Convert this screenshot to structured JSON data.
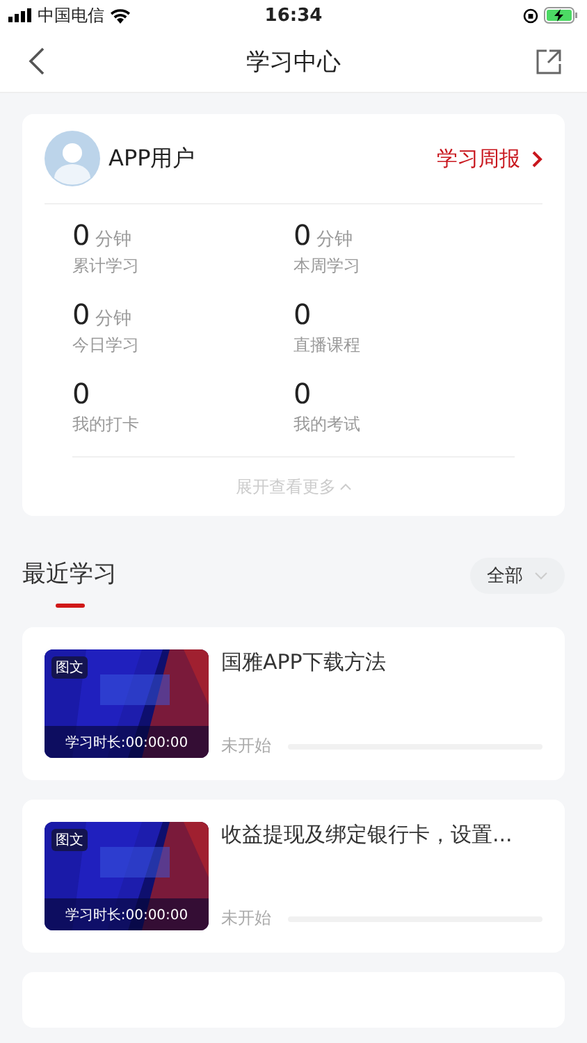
{
  "status_bar": {
    "carrier": "中国电信",
    "time": "16:34",
    "battery_charging": true
  },
  "nav": {
    "title": "学习中心"
  },
  "profile": {
    "name": "APP用户",
    "report_link": "学习周报"
  },
  "stats": [
    {
      "value": "0",
      "unit": "分钟",
      "label": "累计学习"
    },
    {
      "value": "0",
      "unit": "分钟",
      "label": "本周学习"
    },
    {
      "value": "0",
      "unit": "分钟",
      "label": "今日学习"
    },
    {
      "value": "0",
      "label": "直播课程"
    },
    {
      "value": "0",
      "label": "我的打卡"
    },
    {
      "value": "0",
      "label": "我的考试"
    }
  ],
  "expand_more": "展开查看更多",
  "recent": {
    "title": "最近学习",
    "filter": "全部",
    "items": [
      {
        "badge": "图文",
        "duration": "学习时长:00:00:00",
        "title": "国雅APP下载方法",
        "status": "未开始",
        "level": 0
      },
      {
        "badge": "图文",
        "duration": "学习时长:00:00:00",
        "title": "收益提现及绑定银行卡，设置...",
        "status": "未开始",
        "level": 0
      }
    ]
  }
}
